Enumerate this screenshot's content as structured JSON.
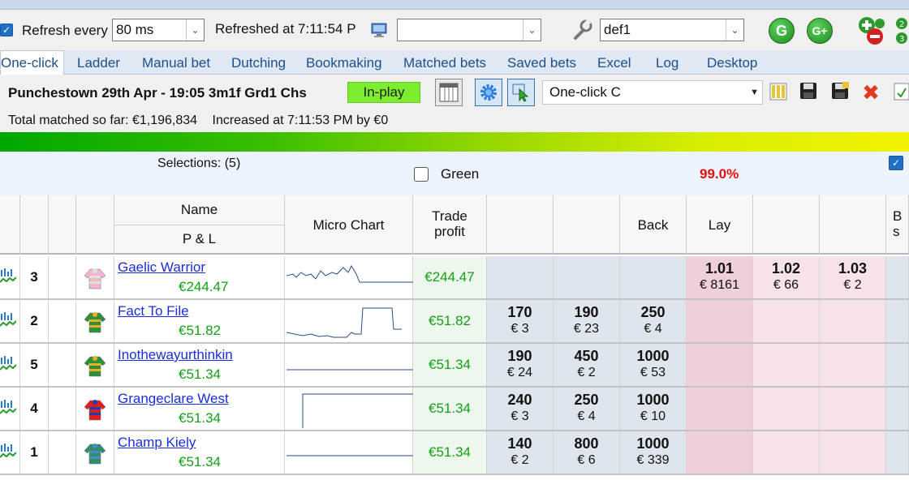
{
  "toolbar": {
    "refresh_label": "Refresh every",
    "refresh_value": "80 ms",
    "refreshed_text": "Refreshed at 7:11:54 P",
    "blank_combo_value": "",
    "profile_value": "def1",
    "g_label": "G",
    "gplus_label": "G+"
  },
  "tabs": [
    "One-click",
    "Ladder",
    "Manual bet",
    "Dutching",
    "Bookmaking",
    "Matched bets",
    "Saved bets",
    "Excel",
    "Log",
    "Desktop"
  ],
  "market": {
    "title": "Punchestown 29th Apr - 19:05 3m1f Grd1 Chs",
    "status": "In-play",
    "view_combo": "One-click C",
    "total_matched": "Total matched so far: €1,196,834",
    "increased": "Increased at 7:11:53 PM by €0"
  },
  "selections": {
    "count_label": "Selections: (5)",
    "green_label": "Green",
    "percent": "99.0%"
  },
  "headers": {
    "name": "Name",
    "pl": "P & L",
    "micro_chart": "Micro Chart",
    "trade_profit": "Trade profit",
    "back": "Back",
    "lay": "Lay",
    "cut_right": "B s"
  },
  "runners": [
    {
      "num": "3",
      "name": "Gaelic Warrior",
      "pl": "€244.47",
      "trade_profit": "€244.47",
      "back": [
        {
          "odds": "",
          "stake": ""
        },
        {
          "odds": "",
          "stake": ""
        },
        {
          "odds": "",
          "stake": ""
        }
      ],
      "lay": [
        {
          "odds": "1.01",
          "stake": "€ 8161"
        },
        {
          "odds": "1.02",
          "stake": "€ 66"
        },
        {
          "odds": "1.03",
          "stake": "€ 2"
        }
      ],
      "silk_colors": [
        "#f4b4d8",
        "#d8e8c8"
      ]
    },
    {
      "num": "2",
      "name": "Fact To File",
      "pl": "€51.82",
      "trade_profit": "€51.82",
      "back": [
        {
          "odds": "170",
          "stake": "€ 3"
        },
        {
          "odds": "190",
          "stake": "€ 23"
        },
        {
          "odds": "250",
          "stake": "€ 4"
        }
      ],
      "lay": [
        {
          "odds": "",
          "stake": ""
        },
        {
          "odds": "",
          "stake": ""
        },
        {
          "odds": "",
          "stake": ""
        }
      ],
      "silk_colors": [
        "#2f8f3a",
        "#e8b020"
      ]
    },
    {
      "num": "5",
      "name": "Inothewayurthinkin",
      "pl": "€51.34",
      "trade_profit": "€51.34",
      "back": [
        {
          "odds": "190",
          "stake": "€ 24"
        },
        {
          "odds": "450",
          "stake": "€ 2"
        },
        {
          "odds": "1000",
          "stake": "€ 53"
        }
      ],
      "lay": [
        {
          "odds": "",
          "stake": ""
        },
        {
          "odds": "",
          "stake": ""
        },
        {
          "odds": "",
          "stake": ""
        }
      ],
      "silk_colors": [
        "#2f8f3a",
        "#e8b020"
      ]
    },
    {
      "num": "4",
      "name": "Grangeclare West",
      "pl": "€51.34",
      "trade_profit": "€51.34",
      "back": [
        {
          "odds": "240",
          "stake": "€ 3"
        },
        {
          "odds": "250",
          "stake": "€ 4"
        },
        {
          "odds": "1000",
          "stake": "€ 10"
        }
      ],
      "lay": [
        {
          "odds": "",
          "stake": ""
        },
        {
          "odds": "",
          "stake": ""
        },
        {
          "odds": "",
          "stake": ""
        }
      ],
      "silk_colors": [
        "#e31b1b",
        "#1f3fae"
      ]
    },
    {
      "num": "1",
      "name": "Champ Kiely",
      "pl": "€51.34",
      "trade_profit": "€51.34",
      "back": [
        {
          "odds": "140",
          "stake": "€ 2"
        },
        {
          "odds": "800",
          "stake": "€ 6"
        },
        {
          "odds": "1000",
          "stake": "€ 339"
        }
      ],
      "lay": [
        {
          "odds": "",
          "stake": ""
        },
        {
          "odds": "",
          "stake": ""
        },
        {
          "odds": "",
          "stake": ""
        }
      ],
      "silk_colors": [
        "#2e8f6a",
        "#4a8bc8"
      ]
    }
  ],
  "colors": {
    "in_play": "#7ded2f",
    "profit_green": "#14a014",
    "percent_red": "#e01010",
    "lay_best": "#f0cfdc",
    "lay": "#f7e1ea",
    "back": "#dfe5ec"
  },
  "icons": [
    "wrench-icon",
    "monitor-icon",
    "g-icon",
    "g-plus-icon",
    "plus-minus-icon",
    "grid-icon",
    "gear-icon",
    "cursor-icon",
    "columns-icon",
    "save-icon",
    "save-add-icon",
    "delete-icon",
    "level-icon",
    "silk-icon"
  ]
}
